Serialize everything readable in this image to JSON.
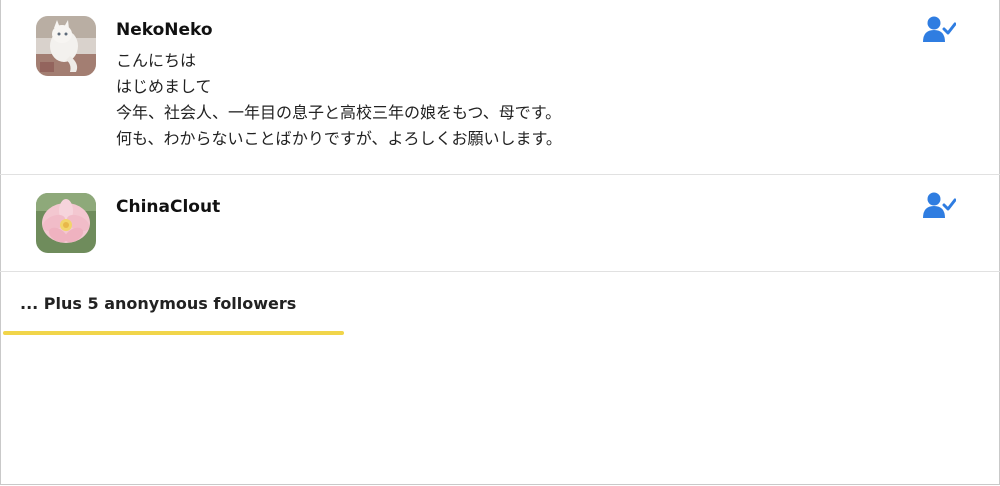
{
  "followers": [
    {
      "name": "NekoNeko",
      "bio": "こんにちは\nはじめまして\n今年、社会人、一年目の息子と高校三年の娘をもつ、母です。\n何も、わからないことばかりですが、よろしくお願いします。",
      "avatar_icon": "cat-avatar",
      "status_icon": "user-check-icon"
    },
    {
      "name": "ChinaClout",
      "bio": "",
      "avatar_icon": "lotus-avatar",
      "status_icon": "user-check-icon"
    }
  ],
  "footer": {
    "anonymous_text": "... Plus 5 anonymous followers"
  },
  "colors": {
    "accent": "#2f7de1",
    "highlight": "#f1d54a",
    "divider": "#e1e1e1"
  }
}
